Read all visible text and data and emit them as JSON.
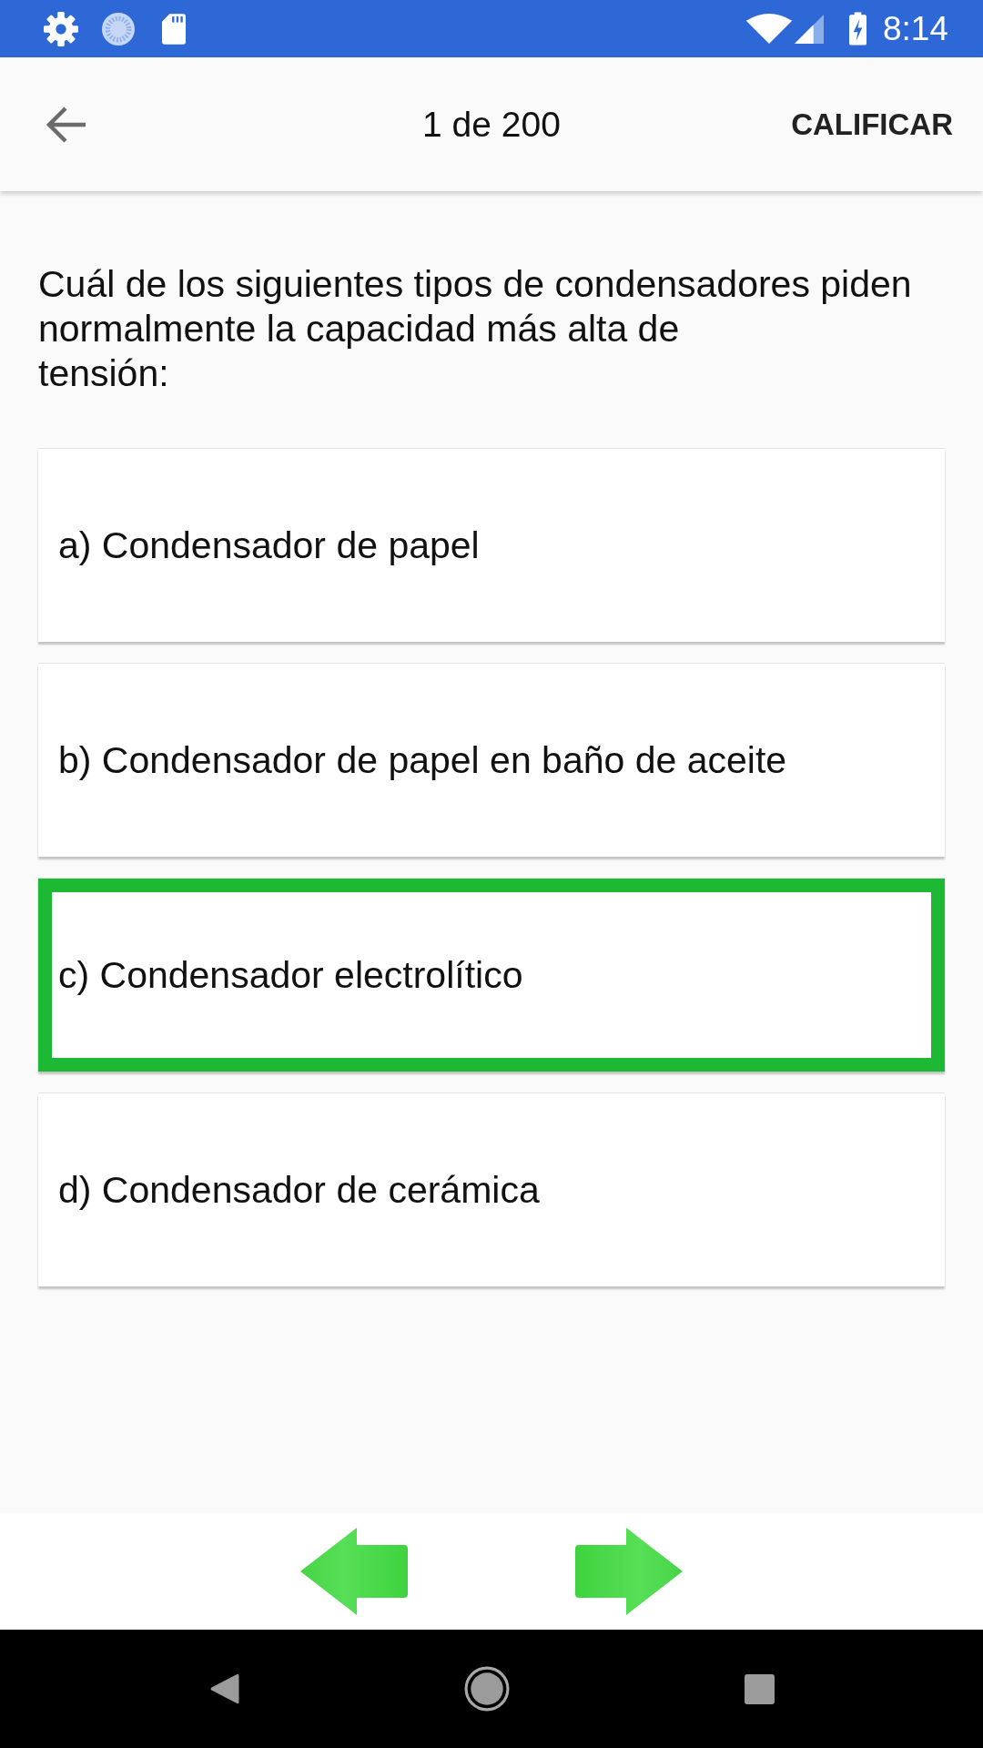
{
  "status_bar": {
    "time": "8:14"
  },
  "app_bar": {
    "title": "1 de 200",
    "action": "CALIFICAR"
  },
  "question": "Cuál de los siguientes tipos de condensadores piden\nnormalmente la capacidad más alta de\ntensión:",
  "options": [
    {
      "label": "a) Condensador de papel",
      "selected": false
    },
    {
      "label": "b) Condensador de papel en baño de aceite",
      "selected": false
    },
    {
      "label": "c) Condensador electrolítico",
      "selected": true
    },
    {
      "label": "d) Condensador de cerámica",
      "selected": false
    }
  ]
}
